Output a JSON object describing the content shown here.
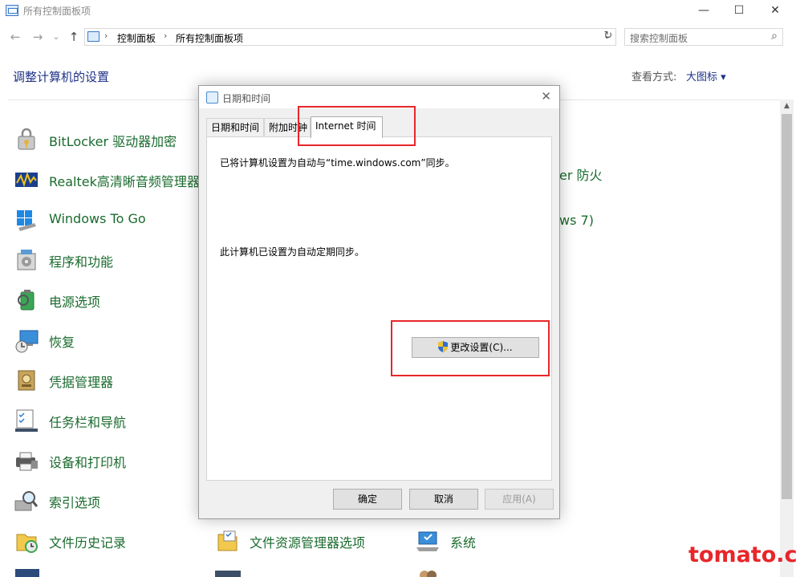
{
  "window": {
    "title": "所有控制面板项",
    "minimize_glyph": "—",
    "maximize_glyph": "☐",
    "close_glyph": "✕"
  },
  "nav": {
    "back_glyph": "←",
    "forward_glyph": "→",
    "recent_glyph": "⌄",
    "up_glyph": "↑",
    "breadcrumb": [
      "控制面板",
      "所有控制面板项"
    ],
    "separator": "›",
    "dropdown_glyph": "⌄",
    "refresh_glyph": "↻",
    "search_placeholder": "搜索控制面板",
    "search_glyph": "⌕"
  },
  "header": {
    "title": "调整计算机的设置",
    "view_by_label": "查看方式:",
    "view_by_value": "大图标 ▾"
  },
  "items_left": [
    {
      "label": "BitLocker 驱动器加密",
      "icon": "bitlocker-icon"
    },
    {
      "label": "Realtek高清晰音频管理器",
      "icon": "realtek-audio-icon"
    },
    {
      "label": "Windows To Go",
      "icon": "windows-to-go-icon"
    },
    {
      "label": "程序和功能",
      "icon": "programs-icon"
    },
    {
      "label": "电源选项",
      "icon": "power-icon"
    },
    {
      "label": "恢复",
      "icon": "recovery-icon"
    },
    {
      "label": "凭据管理器",
      "icon": "credential-icon"
    },
    {
      "label": "任务栏和导航",
      "icon": "taskbar-icon"
    },
    {
      "label": "设备和打印机",
      "icon": "printer-icon"
    },
    {
      "label": "索引选项",
      "icon": "index-icon"
    },
    {
      "label": "文件历史记录",
      "icon": "file-history-icon"
    }
  ],
  "items_right_partial": [
    {
      "label": "er 防火"
    },
    {
      "label": "ws 7)"
    }
  ],
  "items_bottom": [
    {
      "label": "文件资源管理器选项",
      "icon": "file-explorer-options-icon"
    },
    {
      "label": "系统",
      "icon": "system-icon"
    }
  ],
  "dialog": {
    "title": "日期和时间",
    "close_glyph": "✕",
    "tabs": [
      "日期和时间",
      "附加时钟",
      "Internet 时间"
    ],
    "active_tab": 2,
    "sync_text": "已将计算机设置为自动与“time.windows.com”同步。",
    "auto_text": "此计算机已设置为自动定期同步。",
    "change_settings": "更改设置(C)...",
    "ok": "确定",
    "cancel": "取消",
    "apply": "应用(A)"
  },
  "watermark": "tomato.cm",
  "colors": {
    "link_green": "#1a6b2e",
    "header_blue": "#1e3287",
    "highlight_red": "#e8262a"
  }
}
